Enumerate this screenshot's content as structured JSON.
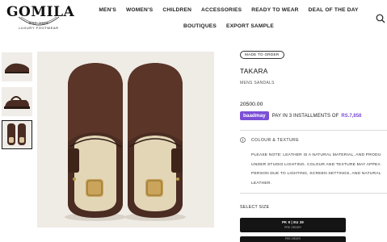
{
  "brand": {
    "name": "GOMILA",
    "arc_text": "EST. 1934",
    "sub_line_1": "LUXURY",
    "sub_line_2": "FOOTWEAR"
  },
  "nav": {
    "row1": [
      "MEN'S",
      "WOMEN'S",
      "CHILDREN",
      "ACCESSORIES",
      "READY TO WEAR",
      "DEAL OF THE DAY"
    ],
    "row2": [
      "BOUTIQUES",
      "EXPORT SAMPLE"
    ]
  },
  "icons": {
    "search": "search-icon",
    "info": "info-icon"
  },
  "product": {
    "badge": "MADE TO ORDER",
    "title": "TAKARA",
    "category": "MENS SANDALS",
    "price": "20500.00",
    "installment": {
      "provider": "baadmay",
      "text": "PAY IN 3 INSTALLMENTS OF",
      "amount": "RS.7,858"
    },
    "colour_section": {
      "title": "COLOUR & TEXTURE",
      "lines": [
        "PLEASE NOTE: LEATHER IS A NATURAL MATERIAL, AND PRODU",
        "UNDER STUDIO LIGHTING. COLOUR AND TEXTURE MAY APPEA",
        "PERSON DUE TO LIGHTING, SCREEN SETTINGS, AND NATURAL",
        "LEATHER."
      ]
    },
    "size": {
      "label": "SELECT SIZE",
      "selected_main": "PK 9 | EU 39",
      "selected_sub": "PRE ORDER",
      "next_sub": "PRE ORDER"
    }
  },
  "colors": {
    "accent": "#7b4fd6",
    "leather": "#4a2c22",
    "background": "#efebe5"
  }
}
